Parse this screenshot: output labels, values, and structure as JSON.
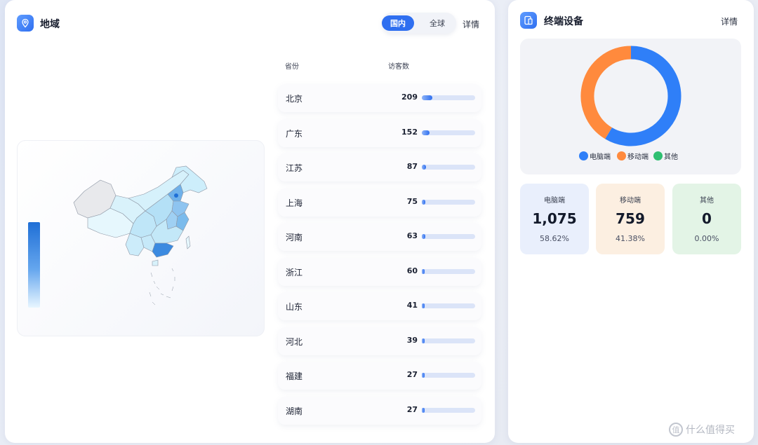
{
  "region": {
    "title": "地域",
    "toggle": {
      "active": "国内",
      "inactive": "全球"
    },
    "detail": "详情",
    "table": {
      "col_province": "省份",
      "col_visitors": "访客数",
      "rows": [
        {
          "province": "北京",
          "visitors": 209
        },
        {
          "province": "广东",
          "visitors": 152
        },
        {
          "province": "江苏",
          "visitors": 87
        },
        {
          "province": "上海",
          "visitors": 75
        },
        {
          "province": "河南",
          "visitors": 63
        },
        {
          "province": "浙江",
          "visitors": 60
        },
        {
          "province": "山东",
          "visitors": 41
        },
        {
          "province": "河北",
          "visitors": 39
        },
        {
          "province": "福建",
          "visitors": 27
        },
        {
          "province": "湖南",
          "visitors": 27
        }
      ]
    }
  },
  "device": {
    "title": "终端设备",
    "detail": "详情",
    "legend": [
      {
        "label": "电脑端",
        "color": "#2f7ff8"
      },
      {
        "label": "移动端",
        "color": "#ff8a3d"
      },
      {
        "label": "其他",
        "color": "#2fbf71"
      }
    ],
    "stats": [
      {
        "label": "电脑端",
        "value": "1,075",
        "percent": "58.62%",
        "bg": "#e9effc"
      },
      {
        "label": "移动端",
        "value": "759",
        "percent": "41.38%",
        "bg": "#fcefe1"
      },
      {
        "label": "其他",
        "value": "0",
        "percent": "0.00%",
        "bg": "#e3f4e6"
      }
    ]
  },
  "chart_data": {
    "type": "pie",
    "categories": [
      "电脑端",
      "移动端",
      "其他"
    ],
    "values": [
      1075,
      759,
      0
    ],
    "colors": [
      "#2f7ff8",
      "#ff8a3d",
      "#2fbf71"
    ]
  },
  "watermark": {
    "text": "什么值得买",
    "icon": "值"
  },
  "colors": {
    "accent": "#2f6ff0",
    "map_max": "#1f6fd6",
    "map_min": "#e8f6ff"
  }
}
